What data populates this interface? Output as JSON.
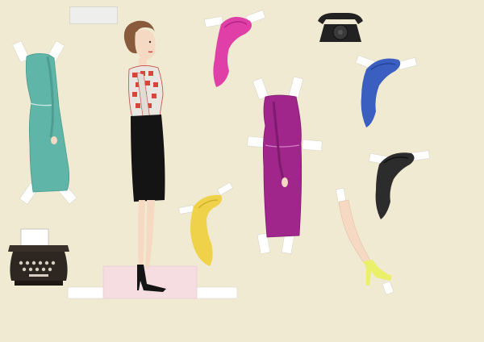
{
  "scene": {
    "signature_text": "",
    "colors": {
      "background": "#f1ead2",
      "skin": "#f5d9c2",
      "hair_brown": "#8a5a3c",
      "blouse_pattern": "#d8453a",
      "skirt": "#141414",
      "shoes": "#141414",
      "stand_pink": "#f5dde2",
      "dress_teal": "#5fb6a8",
      "dress_magenta": "#a0268c",
      "wig_pink": "#df3fa6",
      "wig_blue": "#3a5fc0",
      "wig_yellow": "#f0d24a",
      "wig_black": "#2c2c2c",
      "shoe_yellow": "#eaf06a",
      "phone": "#222222",
      "typewriter": "#2e2620"
    },
    "icons": [
      "rotary-phone-icon",
      "typewriter-icon"
    ]
  }
}
